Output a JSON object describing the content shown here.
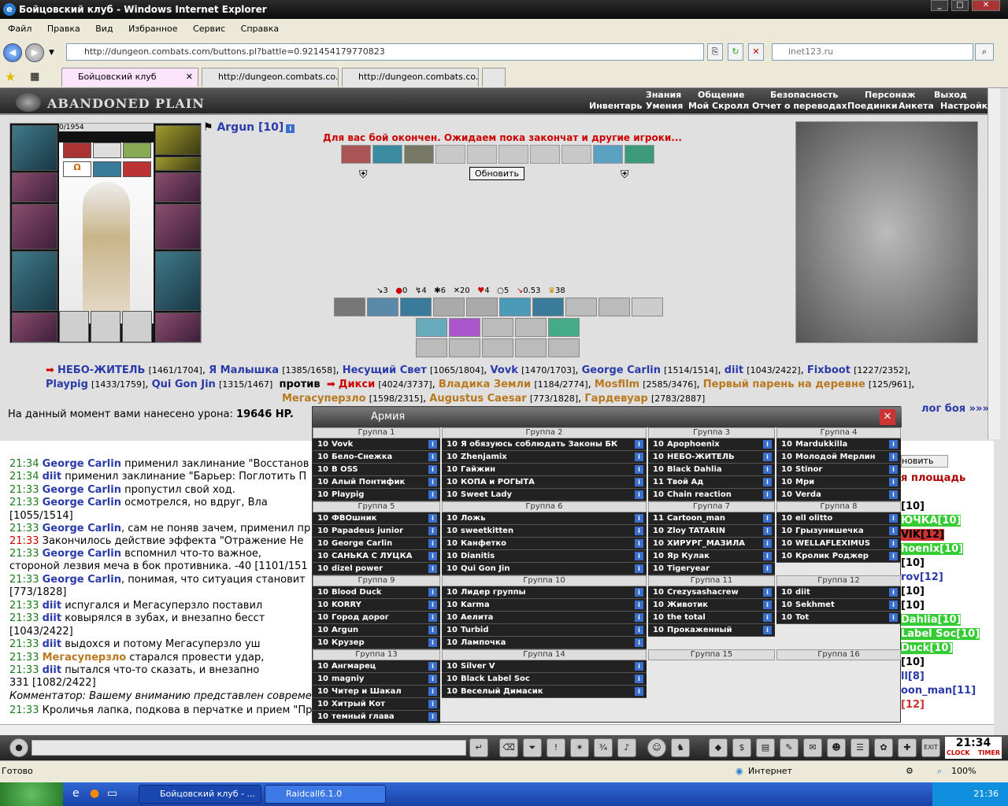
{
  "window": {
    "title": "Бойцовский клуб - Windows Internet Explorer"
  },
  "menu": [
    "Файл",
    "Правка",
    "Вид",
    "Избранное",
    "Сервис",
    "Справка"
  ],
  "address": "http://dungeon.combats.com/buttons.pl?battle=0.921454179770823",
  "search_placeholder": "inet123.ru",
  "tabs": [
    {
      "label": "Бойцовский клуб"
    },
    {
      "label": "http://dungeon.combats.co..."
    },
    {
      "label": "http://dungeon.combats.co..."
    }
  ],
  "game": {
    "logo": "ABANDONED PLAIN",
    "menu_top": [
      "Знания",
      "Общение",
      "Безопасность",
      "Персонаж",
      "Выход"
    ],
    "menu_sub": [
      "Инвентарь",
      "Умения",
      "Мой Скролл",
      "Отчет о переводах",
      "Поединки",
      "Анкета",
      "Настройки"
    ],
    "hp_text": "0/1954",
    "player": "Argun [10]",
    "status": "Для вас бой окончен. Ожидаем пока закончат и другие игроки...",
    "refresh_label": "Обновить",
    "stats": [
      {
        "icon": "sword-icon",
        "value": "3"
      },
      {
        "icon": "drop-icon",
        "value": "0"
      },
      {
        "icon": "claw-icon",
        "value": "4"
      },
      {
        "icon": "gear-icon",
        "value": "6"
      },
      {
        "icon": "cross-swords-icon",
        "value": "20"
      },
      {
        "icon": "heart-icon",
        "value": "4"
      },
      {
        "icon": "shield-icon",
        "value": "5"
      },
      {
        "icon": "arrow-icon",
        "value": "0.53"
      },
      {
        "icon": "crown-icon",
        "value": "38"
      }
    ],
    "damage_label": "На данный момент вами нанесено урона:",
    "damage_value": "19646 HP.",
    "log_button": "лог боя »»»",
    "versus": "против"
  },
  "team1": [
    {
      "name": "НЕБО-ЖИТЕЛЬ",
      "hp": "[1461/1704]"
    },
    {
      "name": "Я Малышка",
      "hp": "[1385/1658]"
    },
    {
      "name": "Несущий Свет",
      "hp": "[1065/1804]"
    },
    {
      "name": "Vovk",
      "hp": "[1470/1703]"
    },
    {
      "name": "George Carlin",
      "hp": "[1514/1514]"
    },
    {
      "name": "diit",
      "hp": "[1043/2422]"
    },
    {
      "name": "Fixboot",
      "hp": "[1227/2352]"
    },
    {
      "name": "Playpig",
      "hp": "[1433/1759]"
    },
    {
      "name": "Qui Gon Jin",
      "hp": "[1315/1467]"
    }
  ],
  "team2": [
    {
      "name": "Дикси",
      "hp": "[4024/3737]"
    },
    {
      "name": "Владика Земли",
      "hp": "[1184/2774]"
    },
    {
      "name": "Mosfilm",
      "hp": "[2585/3476]"
    },
    {
      "name": "Первый парень на деревне",
      "hp": "[125/961]"
    },
    {
      "name": "Мегасуперзло",
      "hp": "[1598/2315]"
    },
    {
      "name": "Augustus Caesar",
      "hp": "[773/1828]"
    },
    {
      "name": "Гардевуар",
      "hp": "[2783/2887]"
    }
  ],
  "log": [
    {
      "time": "21:34",
      "who": "George Carlin",
      "text": "применил заклинание \"Восстанов"
    },
    {
      "time": "21:34",
      "who": "diit",
      "text": "применил заклинание \"Барьер: Поглотить П"
    },
    {
      "time": "21:33",
      "who": "George Carlin",
      "text": "пропустил свой ход."
    },
    {
      "time": "21:33",
      "who": "George Carlin",
      "text": "осмотрелся, но вдруг, Вла"
    },
    {
      "time": "",
      "who": "",
      "text": "[1055/1514]"
    },
    {
      "time": "21:33",
      "who": "George Carlin",
      "text": ", сам не поняв зачем, применил пр"
    },
    {
      "time": "21:33",
      "who": "",
      "text": "Закончилось действие эффекта \"Отражение Не"
    },
    {
      "time": "21:33",
      "who": "George Carlin",
      "text": "вспомнил что-то важное,"
    },
    {
      "time": "",
      "who": "",
      "text": "стороной лезвия меча в бок противника. -40 [1101/151"
    },
    {
      "time": "21:33",
      "who": "George Carlin",
      "text": ", понимая, что ситуация становит"
    },
    {
      "time": "",
      "who": "",
      "text": "[773/1828]"
    },
    {
      "time": "21:33",
      "who": "diit",
      "text": "испугался и Мегасуперзло поставил"
    },
    {
      "time": "21:33",
      "who": "diit",
      "text": "ковырялся в зубах, и внезапно бесст"
    },
    {
      "time": "",
      "who": "",
      "text": "[1043/2422]"
    },
    {
      "time": "21:33",
      "who": "diit",
      "text": "выдохся и потому Мегасуперзло уш"
    },
    {
      "time": "21:33",
      "who": "Мегасуперзло",
      "text": "старался провести удар,"
    },
    {
      "time": "21:33",
      "who": "diit",
      "text": "пытался что-то сказать, и внезапно"
    },
    {
      "time": "",
      "who": "",
      "text": "331 [1082/2422]"
    },
    {
      "time": "",
      "who": "",
      "text": "Комментатор: Вашему вниманию представлен современ"
    },
    {
      "time": "21:33",
      "who": "",
      "text": "Кроличья лапка, подкова в перчатке и прием \"Пр"
    }
  ],
  "army": {
    "title": "Армия",
    "groups": [
      {
        "name": "Группа 1",
        "members": [
          [
            "10",
            "Vovk"
          ],
          [
            "10",
            "Бело-Снежка"
          ],
          [
            "10",
            "B OSS"
          ],
          [
            "10",
            "Алый Понтифик"
          ],
          [
            "10",
            "Playpig"
          ]
        ]
      },
      {
        "name": "Группа 2",
        "members": [
          [
            "10",
            "Я обязуюсь соблюдать Законы БК"
          ],
          [
            "10",
            "Zhenjamix"
          ],
          [
            "10",
            "Гайжин"
          ],
          [
            "10",
            "КОПА и РОГЫТА"
          ],
          [
            "10",
            "Sweet Lady"
          ]
        ]
      },
      {
        "name": "Группа 3",
        "members": [
          [
            "10",
            "Apophoenix"
          ],
          [
            "10",
            "НЕБО-ЖИТЕЛЬ"
          ],
          [
            "10",
            "Black Dahlia"
          ],
          [
            "11",
            "Твой Ад"
          ],
          [
            "10",
            "Chain reaction"
          ]
        ]
      },
      {
        "name": "Группа 4",
        "members": [
          [
            "10",
            "Mardukkilla"
          ],
          [
            "10",
            "Молодой Мерлин"
          ],
          [
            "10",
            "Stinor"
          ],
          [
            "10",
            "Мри"
          ],
          [
            "10",
            "Verda"
          ]
        ]
      },
      {
        "name": "Группа 5",
        "members": [
          [
            "10",
            "ФВОшник"
          ],
          [
            "10",
            "Papadeus junior"
          ],
          [
            "10",
            "George Carlin"
          ],
          [
            "10",
            "САНЬКА С ЛУЦКА"
          ],
          [
            "10",
            "dizel power"
          ]
        ]
      },
      {
        "name": "Группа 6",
        "members": [
          [
            "10",
            "Ложь"
          ],
          [
            "10",
            "sweetkitten"
          ],
          [
            "10",
            "Канфетко"
          ],
          [
            "10",
            "Dianitis"
          ],
          [
            "10",
            "Qui Gon Jin"
          ]
        ]
      },
      {
        "name": "Группа 7",
        "members": [
          [
            "11",
            "Cartoon_man"
          ],
          [
            "10",
            "Zloy TATARIN"
          ],
          [
            "10",
            "ХИРУРГ_МАЗИЛА"
          ],
          [
            "10",
            "Яр Кулак"
          ],
          [
            "10",
            "Tigeryear"
          ]
        ]
      },
      {
        "name": "Группа 8",
        "members": [
          [
            "10",
            "ell olitto"
          ],
          [
            "10",
            "Грызунишечка"
          ],
          [
            "10",
            "WELLAFLEXIMUS"
          ],
          [
            "10",
            "Кролик Роджер"
          ]
        ]
      },
      {
        "name": "Группа 9",
        "members": [
          [
            "10",
            "Blood Duck"
          ],
          [
            "10",
            "KORRY"
          ],
          [
            "10",
            "Город дорог"
          ],
          [
            "10",
            "Argun"
          ],
          [
            "10",
            "Крузер"
          ]
        ]
      },
      {
        "name": "Группа 10",
        "members": [
          [
            "10",
            "Лидер группы"
          ],
          [
            "10",
            "Karma"
          ],
          [
            "10",
            "Аелита"
          ],
          [
            "10",
            "Turbid"
          ],
          [
            "10",
            "Лампочка"
          ]
        ]
      },
      {
        "name": "Группа 11",
        "members": [
          [
            "10",
            "Crezysashacrew"
          ],
          [
            "10",
            "Животик"
          ],
          [
            "10",
            "the total"
          ],
          [
            "10",
            "Прокаженный"
          ]
        ]
      },
      {
        "name": "Группа 12",
        "members": [
          [
            "10",
            "diit"
          ],
          [
            "10",
            "Sekhmet"
          ],
          [
            "10",
            "Tot"
          ]
        ]
      },
      {
        "name": "Группа 13",
        "members": [
          [
            "10",
            "Ангмарец"
          ],
          [
            "10",
            "magniy"
          ],
          [
            "10",
            "Читер и Шакал"
          ],
          [
            "10",
            "Хитрый Кот"
          ],
          [
            "10",
            "темный глава"
          ]
        ]
      },
      {
        "name": "Группа 14",
        "members": [
          [
            "10",
            "Silver V"
          ],
          [
            "10",
            "Black Label Soc"
          ],
          [
            "10",
            "Веселый Димасик"
          ]
        ]
      },
      {
        "name": "Группа 15",
        "members": []
      },
      {
        "name": "Группа 16",
        "members": []
      }
    ]
  },
  "right_panel": {
    "refresh_partial": "новить",
    "location": "я площадь",
    "names": [
      "[10]",
      "ЮЧКА[10]",
      "VIK[12]",
      "hoenix[10]",
      "rov[12]",
      "[10]",
      "[10]",
      "[10]",
      "Dahlia[10]",
      "Label Soc[10]",
      "Duck[10]",
      "[10]",
      "ll[8]",
      "oon_man[11]",
      "[12]"
    ]
  },
  "clock": {
    "time": "21:34",
    "labels": [
      "CLOCK",
      "TIMER"
    ]
  },
  "statusbar": {
    "left": "Готово",
    "zone": "Интернет",
    "zoom": "100%"
  },
  "taskbar": {
    "items": [
      "Бойцовский клуб - ...",
      "Raidcall6.1.0"
    ],
    "time": "21:36"
  }
}
